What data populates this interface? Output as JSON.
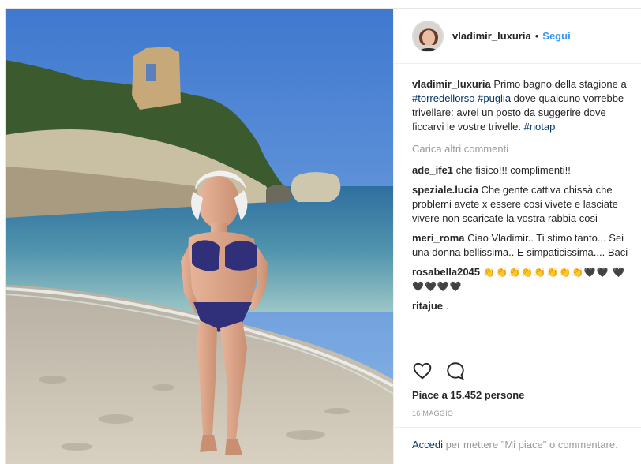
{
  "post": {
    "username": "vladimir_luxuria",
    "separator": "•",
    "follow_label": "Segui",
    "caption": {
      "username": "vladimir_luxuria",
      "text_1": " Primo bagno della stagione a ",
      "tag_1": "#torredellorso",
      "text_2": " ",
      "tag_2": "#puglia",
      "text_3": " dove qualcuno vorrebbe trivellare: avrei un posto da suggerire dove ficcarvi le vostre trivelle. ",
      "tag_3": "#notap"
    },
    "load_more_label": "Carica altri commenti",
    "comments": [
      {
        "username": "ade_ife1",
        "text": " che fisico!!! complimenti!!"
      },
      {
        "username": "speziale.lucia",
        "text": " Che gente cattiva chissà che problemi avete x essere cosi vivete e lasciate vivere non scaricate la vostra rabbia cosi"
      },
      {
        "username": "meri_roma",
        "text": " Ciao Vladimir.. Ti stimo tanto... Sei una donna bellissima.. E simpaticissima.... Baci"
      },
      {
        "username": "rosabella2045",
        "text": " 👏👏👏👏👏👏👏👏🖤🖤 🖤🖤🖤🖤🖤"
      },
      {
        "username": "ritajue",
        "text": " ."
      }
    ],
    "likes_label": "Piace a 15.452 persone",
    "date_label": "16 MAGGIO",
    "login": {
      "link": "Accedi",
      "text": " per mettere \"Mi piace\" o commentare."
    }
  },
  "icons": {
    "like": "heart-icon",
    "comment": "comment-bubble-icon"
  },
  "colors": {
    "link_blue": "#3897f0",
    "tag_blue": "#003569",
    "muted": "#999999",
    "text": "#262626"
  }
}
